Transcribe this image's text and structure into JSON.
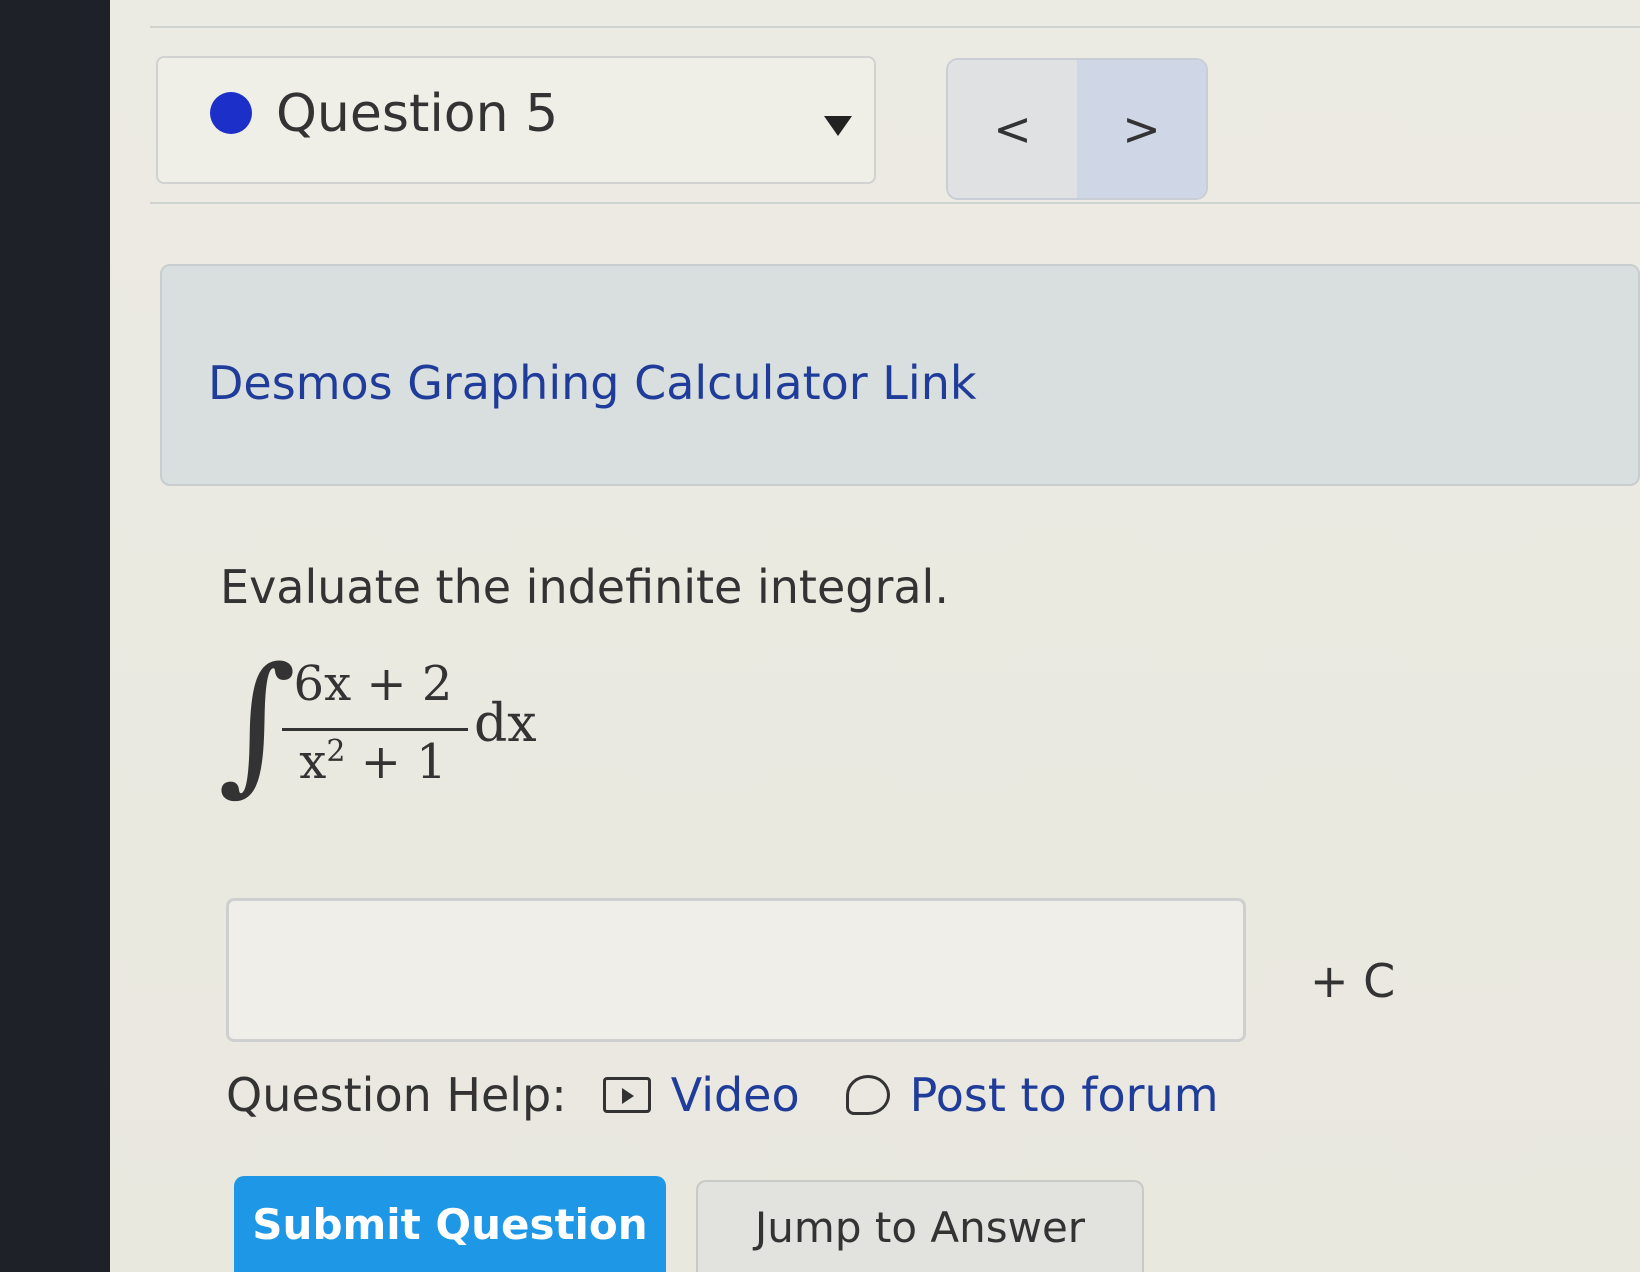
{
  "question_selector": {
    "label": "Question 5",
    "status_dot_color": "#1c2fc8"
  },
  "nav": {
    "prev_label": "<",
    "next_label": ">"
  },
  "calculator_link": {
    "label": "Desmos Graphing Calculator Link"
  },
  "question": {
    "prompt": "Evaluate the indefinite integral.",
    "integral": {
      "sign": "∫",
      "numerator": "6x + 2",
      "denominator_base": "x",
      "denominator_exp": "2",
      "denominator_rest": " + 1",
      "differential": "dx"
    }
  },
  "answer": {
    "value": "",
    "suffix": "+ C"
  },
  "help": {
    "label": "Question Help:",
    "video_label": "Video",
    "forum_label": "Post to forum"
  },
  "actions": {
    "submit_label": "Submit Question",
    "jump_label": "Jump to Answer"
  },
  "colors": {
    "link_blue": "#1f3c9a",
    "submit_blue": "#1e97e6"
  }
}
